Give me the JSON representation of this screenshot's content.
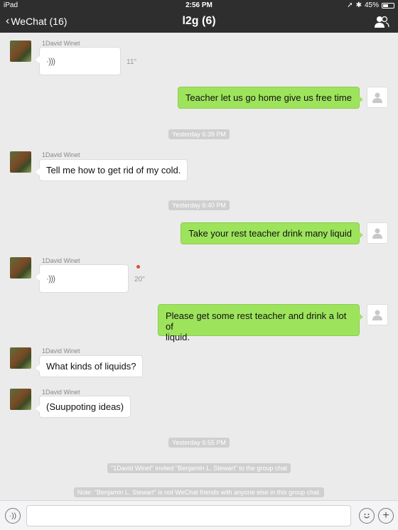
{
  "status": {
    "device": "iPad",
    "time": "2:56 PM",
    "battery": "45%",
    "battery_level": 0.45
  },
  "nav": {
    "back_label": "WeChat (16)",
    "title": "l2g (6)"
  },
  "messages": {
    "m1": {
      "sender": "1David Winet",
      "duration": "11\""
    },
    "m2": {
      "text": "Teacher let us go home give us free time"
    },
    "t1": "Yesterday 6:39 PM",
    "m3": {
      "sender": "1David Winet",
      "text": "Tell me how to get rid of my cold."
    },
    "t2": "Yesterday 6:40 PM",
    "m4": {
      "text": "Take your rest teacher drink many liquid"
    },
    "m5": {
      "sender": "1David Winet",
      "duration": "20\""
    },
    "m6": {
      "text_line1": "Please get some rest teacher and drink a lot of",
      "text_line2": "liquid."
    },
    "m7": {
      "sender": "1David Winet",
      "text": "What kinds of liquids?"
    },
    "m8": {
      "sender": "1David Winet",
      "text": "(Suuppoting ideas)"
    },
    "t3": "Yesterday 6:55 PM",
    "sys1": "\"1David Winet\" invited \"Benjamin L. Stewart\" to the group chat",
    "sys2": "Note: \"Benjamin L. Stewart\" is not WeChat friends with anyone else in this group chat."
  },
  "colors": {
    "outgoing_bubble": "#9de45c",
    "header_bg": "#2e2e2e",
    "unread_dot": "#e4493c"
  }
}
